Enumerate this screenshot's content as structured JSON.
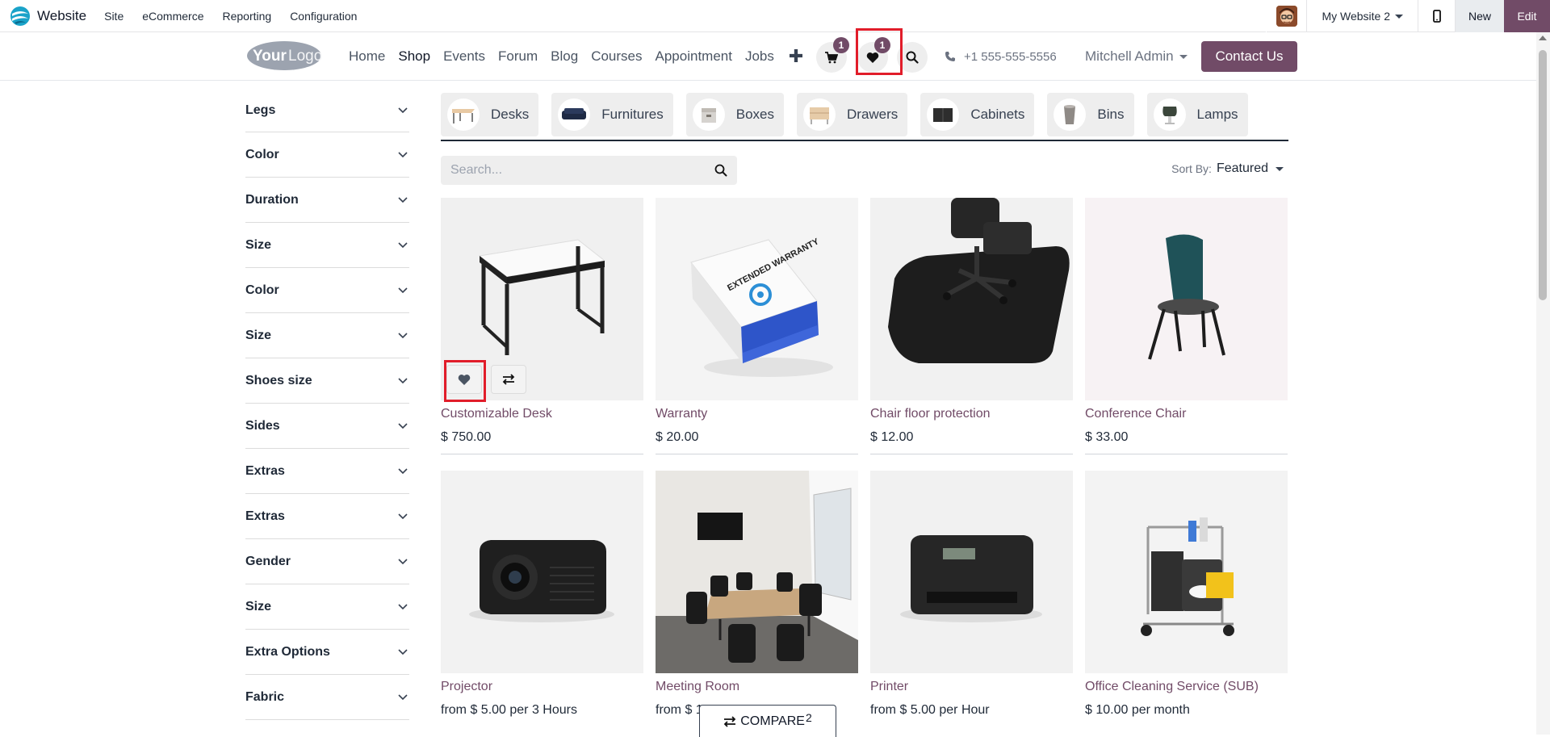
{
  "admin_bar": {
    "app_name": "Website",
    "menus": [
      "Site",
      "eCommerce",
      "Reporting",
      "Configuration"
    ],
    "website_switcher": "My Website 2",
    "new_label": "New",
    "edit_label": "Edit"
  },
  "header": {
    "logo_text": "YourLogo",
    "nav": [
      "Home",
      "Shop",
      "Events",
      "Forum",
      "Blog",
      "Courses",
      "Appointment",
      "Jobs"
    ],
    "active_nav": "Shop",
    "cart_count": "1",
    "wishlist_count": "1",
    "phone": "+1 555-555-5556",
    "user": "Mitchell Admin",
    "contact_label": "Contact Us"
  },
  "sidebar": {
    "filters": [
      "Legs",
      "Color",
      "Duration",
      "Size",
      "Color",
      "Size",
      "Shoes size",
      "Sides",
      "Extras",
      "Extras",
      "Gender",
      "Size",
      "Extra Options",
      "Fabric"
    ]
  },
  "categories": [
    "Desks",
    "Furnitures",
    "Boxes",
    "Drawers",
    "Cabinets",
    "Bins",
    "Lamps"
  ],
  "search": {
    "placeholder": "Search..."
  },
  "sort": {
    "label": "Sort By:",
    "value": "Featured"
  },
  "products": [
    {
      "name": "Customizable Desk",
      "price": "$ 750.00"
    },
    {
      "name": "Warranty",
      "price": "$ 20.00"
    },
    {
      "name": "Chair floor protection",
      "price": "$ 12.00"
    },
    {
      "name": "Conference Chair",
      "price": "$ 33.00"
    },
    {
      "name": "Projector",
      "price": "from $ 5.00 per 3 Hours"
    },
    {
      "name": "Meeting Room",
      "price": "from $ 1"
    },
    {
      "name": "Printer",
      "price": "from $ 5.00 per Hour"
    },
    {
      "name": "Office Cleaning Service (SUB)",
      "price": "$ 10.00 per month"
    }
  ],
  "warranty_box_text": "EXTENDED WARRANTY",
  "compare": {
    "label": "COMPARE",
    "count": "2"
  },
  "colors": {
    "brand": "#714b67",
    "highlight": "#e11d2a"
  }
}
